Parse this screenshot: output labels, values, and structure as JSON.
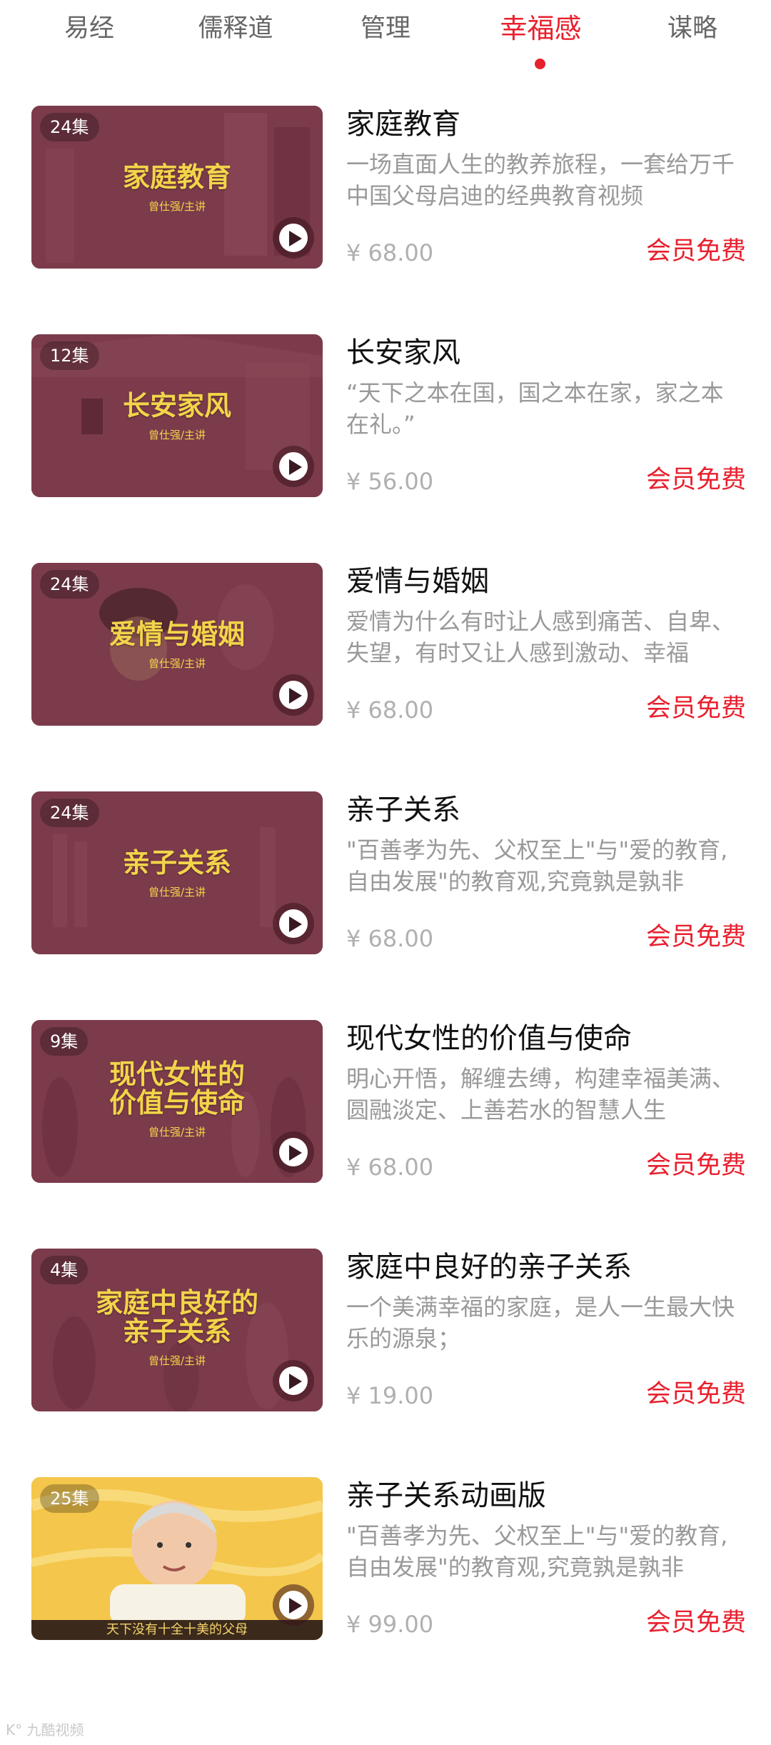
{
  "tabs": [
    {
      "label": "易经",
      "active": false
    },
    {
      "label": "儒释道",
      "active": false
    },
    {
      "label": "管理",
      "active": false
    },
    {
      "label": "幸福感",
      "active": true
    },
    {
      "label": "谋略",
      "active": false
    }
  ],
  "courses": [
    {
      "episodes": "24集",
      "thumb_title": "家庭教育",
      "thumb_sub": "曾仕强/主讲",
      "title": "家庭教育",
      "desc": "一场直面人生的教养旅程，一套给万千中国父母启迪的经典教育视频",
      "price": "¥ 68.00",
      "vip": "会员免费"
    },
    {
      "episodes": "12集",
      "thumb_title": "长安家风",
      "thumb_sub": "曾仕强/主讲",
      "title": "长安家风",
      "desc": "“天下之本在国，国之本在家，家之本在礼。”",
      "price": "¥ 56.00",
      "vip": "会员免费"
    },
    {
      "episodes": "24集",
      "thumb_title": "爱情与婚姻",
      "thumb_sub": "曾仕强/主讲",
      "title": "爱情与婚姻",
      "desc": "爱情为什么有时让人感到痛苦、自卑、失望，有时又让人感到激动、幸福",
      "price": "¥ 68.00",
      "vip": "会员免费"
    },
    {
      "episodes": "24集",
      "thumb_title": "亲子关系",
      "thumb_sub": "曾仕强/主讲",
      "title": "亲子关系",
      "desc": "\"百善孝为先、父权至上\"与\"爱的教育,自由发展\"的教育观,究竟孰是孰非",
      "price": "¥ 68.00",
      "vip": "会员免费"
    },
    {
      "episodes": "9集",
      "thumb_title": "现代女性的\n价值与使命",
      "thumb_sub": "曾仕强/主讲",
      "title": "现代女性的价值与使命",
      "desc": "明心开悟，解缠去缚，构建幸福美满、圆融淡定、上善若水的智慧人生",
      "price": "¥ 68.00",
      "vip": "会员免费"
    },
    {
      "episodes": "4集",
      "thumb_title": "家庭中良好的\n亲子关系",
      "thumb_sub": "曾仕强/主讲",
      "title": "家庭中良好的亲子关系",
      "desc": "一个美满幸福的家庭，是人一生最大快乐的源泉；",
      "price": "¥ 19.00",
      "vip": "会员免费"
    },
    {
      "episodes": "25集",
      "thumb_title": "",
      "thumb_sub": "",
      "thumb_strip": "天下没有十全十美的父母",
      "title": "亲子关系动画版",
      "desc": "\"百善孝为先、父权至上\"与\"爱的教育,自由发展\"的教育观,究竟孰是孰非",
      "price": "¥ 99.00",
      "vip": "会员免费"
    }
  ],
  "watermark": "K° 九酷视频",
  "colors": {
    "accent": "#e8202e",
    "thumb_bg": "#7b3b4b",
    "thumb_text": "#f3d44a"
  }
}
